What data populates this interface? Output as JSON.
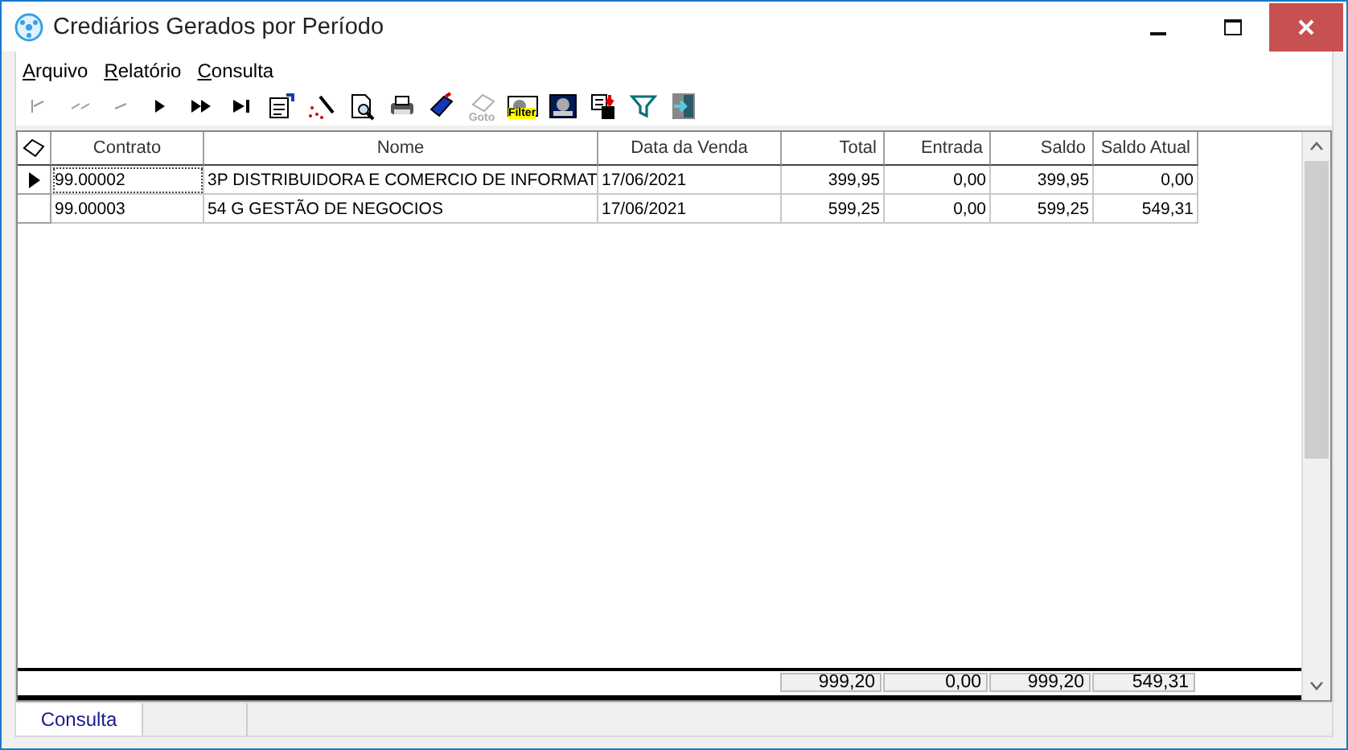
{
  "window": {
    "title": "Crediários Gerados por Período"
  },
  "menu": [
    {
      "label": "Arquivo"
    },
    {
      "label": "Relatório"
    },
    {
      "label": "Consulta"
    }
  ],
  "toolbar": [
    {
      "kind": "first",
      "disabled": true
    },
    {
      "kind": "prior-page",
      "disabled": true
    },
    {
      "kind": "prior",
      "disabled": true
    },
    {
      "kind": "next",
      "disabled": false
    },
    {
      "kind": "next-page",
      "disabled": false
    },
    {
      "kind": "last",
      "disabled": false
    },
    {
      "kind": "properties",
      "disabled": false
    },
    {
      "kind": "wand",
      "disabled": false
    },
    {
      "kind": "preview",
      "disabled": false
    },
    {
      "kind": "print",
      "disabled": false
    },
    {
      "kind": "tag",
      "disabled": false
    },
    {
      "kind": "goto",
      "caption": "Goto",
      "disabled": true
    },
    {
      "kind": "filter-box",
      "caption": "Filter",
      "disabled": false
    },
    {
      "kind": "picture",
      "disabled": false
    },
    {
      "kind": "export",
      "disabled": false
    },
    {
      "kind": "funnel",
      "disabled": false
    },
    {
      "kind": "exit",
      "disabled": false
    }
  ],
  "table": {
    "columns": [
      {
        "label": "Contrato"
      },
      {
        "label": "Nome"
      },
      {
        "label": "Data da Venda"
      },
      {
        "label": "Total"
      },
      {
        "label": "Entrada"
      },
      {
        "label": "Saldo"
      },
      {
        "label": "Saldo Atual"
      }
    ],
    "rows": [
      {
        "selected": true,
        "cells": [
          "99.00002",
          "3P  DISTRIBUIDORA E COMERCIO DE INFORMAT",
          "17/06/2021",
          "399,95",
          "0,00",
          "399,95",
          "0,00"
        ]
      },
      {
        "selected": false,
        "cells": [
          "99.00003",
          "54 G GESTÃO DE NEGOCIOS",
          "17/06/2021",
          "599,25",
          "0,00",
          "599,25",
          "549,31"
        ]
      }
    ],
    "totals": [
      "999,20",
      "0,00",
      "999,20",
      "549,31"
    ]
  },
  "status_bar": [
    {
      "label": "Consulta"
    }
  ]
}
